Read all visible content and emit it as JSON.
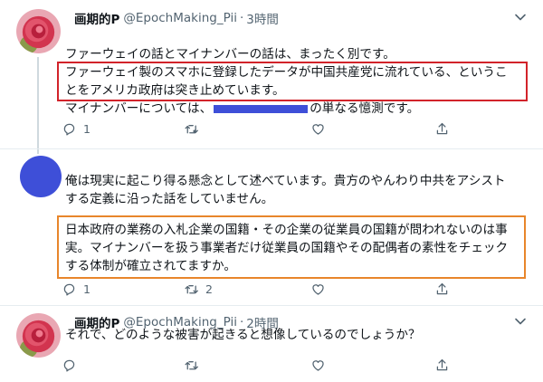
{
  "tweets": [
    {
      "name": "画期的P",
      "handle": "@EpochMaking_Pii",
      "separator": "·",
      "time": "3時間",
      "lines": [
        "ファーウェイの話とマイナンバーの話は、まったく別です。",
        "ファーウェイ製のスマホに登録したデータが中国共産党に流れている、というこ",
        "とをアメリカ政府は突き止めています。"
      ],
      "last_line_prefix": "マイナンバーについては、",
      "last_line_suffix": "の単なる憶測です。",
      "reply_count": "1",
      "retweet_count": "",
      "like_count": ""
    },
    {
      "lines": [
        "俺は現実に起こり得る懸念として述べています。貴方のやんわり中共をアシスト",
        "する定義に沿った話をしていません。"
      ],
      "box_lines": [
        "日本政府の業務の入札企業の国籍・その企業の従業員の国籍が問われないのは事",
        "実。マイナンバーを扱う事業者だけ従業員の国籍やその配偶者の素性をチェック",
        "する体制が確立されてますか。"
      ],
      "reply_count": "1",
      "retweet_count": "2",
      "like_count": ""
    },
    {
      "name": "画期的P",
      "handle": "@EpochMaking_Pii",
      "separator": "·",
      "time": "2時間",
      "lines": [
        "それで、どのような被害が起きると想像しているのでしょうか？"
      ],
      "reply_count": "",
      "retweet_count": "",
      "like_count": ""
    }
  ],
  "icons": {
    "reply": "reply-icon",
    "retweet": "retweet-icon",
    "like": "heart-icon",
    "share": "share-icon",
    "more": "chevron-down-icon"
  },
  "colors": {
    "highlight_red": "#d2232a",
    "highlight_orange": "#e8862b",
    "redaction": "#3e4fd8",
    "avatar_blue": "#3e4fd8"
  }
}
